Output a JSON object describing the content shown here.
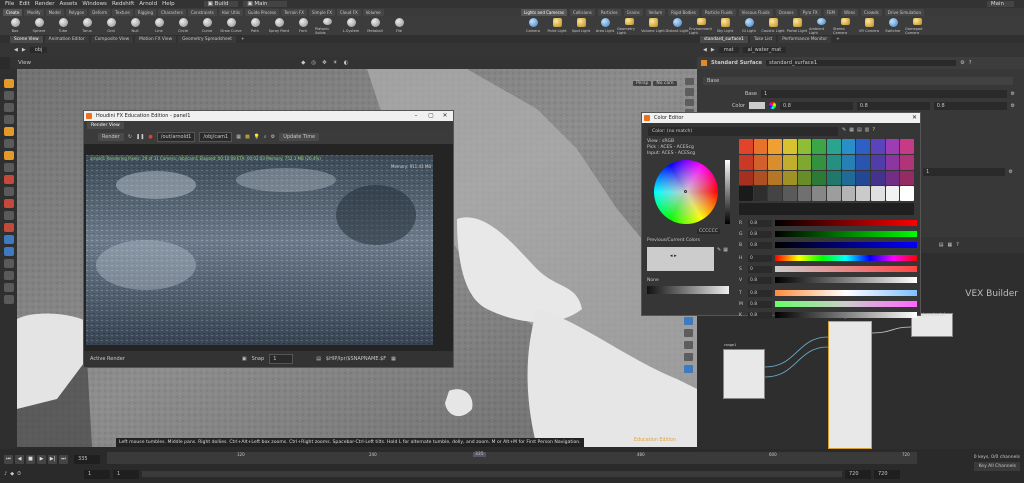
{
  "menubar": {
    "items": [
      "File",
      "Edit",
      "Render",
      "Assets",
      "Windows",
      "Redshift",
      "Arnold",
      "Help"
    ],
    "build": "Build",
    "main": "Main",
    "main_right": "Main"
  },
  "shelf": {
    "tabs": [
      "Create",
      "Modify",
      "Model",
      "Polygon",
      "Deform",
      "Texture",
      "Rigging",
      "Characters",
      "Constraints",
      "Hair Utils",
      "Guide Process",
      "Terrain FX",
      "Simple FX",
      "Cloud FX",
      "Volume"
    ],
    "tools": [
      "Box",
      "Sphere",
      "Tube",
      "Torus",
      "Grid",
      "Null",
      "Line",
      "Circle",
      "Curve",
      "Draw Curve",
      "Path",
      "Spray Paint",
      "Font",
      "Platonic Solids",
      "L-System",
      "Metaball",
      "File"
    ],
    "tabs_right": [
      "Lights and Cameras",
      "Collisions",
      "Particles",
      "Grains",
      "Vellum",
      "Rigid Bodies",
      "Particle Fluids",
      "Viscous Fluids",
      "Oceans",
      "Pyro FX",
      "FEM",
      "Wires",
      "Crowds",
      "Drive Simulation"
    ],
    "tools_right": [
      "Camera",
      "Point Light",
      "Spot Light",
      "Area Light",
      "Geometry Light",
      "Volume Light",
      "Distant Light",
      "Environment Light",
      "Sky Light",
      "GI Light",
      "Caustic Light",
      "Portal Light",
      "Ambient Light",
      "Stereo Camera",
      "VR Camera",
      "Switcher",
      "Gamepad Camera"
    ]
  },
  "panes": {
    "tabs_left": [
      "Scene View",
      "Animation Editor",
      "Composite View",
      "Motion FX View",
      "Geometry Spreadsheet"
    ],
    "tabs_right": [
      "standard_surface1",
      "Take List",
      "Performance Monitor"
    ],
    "path_left": "obj",
    "path_right": "mat",
    "path_right_node": "ai_water_mat",
    "view_label": "View",
    "persp": "Persp",
    "nocam": "No cam"
  },
  "viewport": {
    "status_message": "Left mouse tumbles. Middle pans. Right dollies. Ctrl+Alt+Left box zooms. Ctrl+Right zooms. Spacebar-Ctrl-Left tilts. Hold L for alternate tumble, dolly, and zoom.    M or Alt+M for First Person Navigation.",
    "edu_label": "Education Edition"
  },
  "render_view": {
    "title": "Houdini FX Education Edition - panel1",
    "tab": "Render View",
    "render_btn": "Render",
    "rop_path": "/out/arnold1",
    "cam_path": "/obj/cam1",
    "update_time": "Update Time",
    "overlay_text": "arnold1  Rendering  Pixels: 29 of 31  Camera: /obj/cam1  Elapsed: 00:10:08  ETA: 00:02:03  Memory: 752.3 MB (26.4%)",
    "overlay_mem": "Memory: 911.43 MB",
    "active_render": "Active Render",
    "snap_label": "Snap",
    "snap_value": "1",
    "snapname": "$HIP/lpr/$SNAPNAME.$F"
  },
  "param": {
    "type": "Standard Surface",
    "name": "standard_surface1",
    "section": "Base",
    "base_label": "Base",
    "base_value": "1",
    "color_label": "Color",
    "color_values": [
      "0.8",
      "0.8",
      "0.8"
    ],
    "row2_value": "1"
  },
  "color_editor": {
    "title": "Color Editor",
    "match": "Color: (no match)",
    "view": "View : sRGB",
    "pick": "Pick : ACES - ACEScg",
    "input": "Input: ACES - ACEScg",
    "hex": "CCCCCC",
    "prev_label": "Previous/Current Colors",
    "none_label": "None",
    "sliders": [
      {
        "label": "R",
        "value": "0.8"
      },
      {
        "label": "G",
        "value": "0.8"
      },
      {
        "label": "B",
        "value": "0.8"
      },
      {
        "label": "H",
        "value": "0"
      },
      {
        "label": "S",
        "value": "0"
      },
      {
        "label": "V",
        "value": "0.8"
      },
      {
        "label": "T",
        "value": "0.8"
      },
      {
        "label": "M",
        "value": "0.8"
      },
      {
        "label": "K",
        "value": "0.8"
      }
    ],
    "swatch_colors": [
      "#e0442b",
      "#e8712c",
      "#f0a030",
      "#d9c22f",
      "#8fbd35",
      "#3aa648",
      "#2aa38f",
      "#2b8fc7",
      "#2e5fc4",
      "#5a44bd",
      "#9b3db5",
      "#c73a86",
      "#c93a26",
      "#d0612a",
      "#d98d2c",
      "#c2ad2c",
      "#7ea82f",
      "#339240",
      "#25907f",
      "#2680b3",
      "#2955b0",
      "#503da9",
      "#8a37a2",
      "#b23478",
      "#a53020",
      "#ad5124",
      "#b57626",
      "#a09126",
      "#688d28",
      "#2b7a36",
      "#1f786a",
      "#206a96",
      "#234893",
      "#43338d",
      "#722e87",
      "#942b63",
      "#1a1a1a",
      "#2e2e2e",
      "#444444",
      "#5a5a5a",
      "#707070",
      "#878787",
      "#9d9d9d",
      "#b4b4b4",
      "#cacaca",
      "#e0e0e0",
      "#f2f2f2",
      "#ffffff"
    ]
  },
  "network": {
    "title": "VEX Builder",
    "node_range": "range1",
    "node_surface": "standard_surface1",
    "node_output": "ai_material"
  },
  "timeline": {
    "frame": "335",
    "start": "1",
    "start2": "1",
    "end": "720",
    "end2": "720",
    "ticks": [
      "120",
      "240",
      "335",
      "480",
      "600",
      "720"
    ],
    "keys": "0 keys, 0/0 channels",
    "all_channels": "Key All Channels"
  }
}
